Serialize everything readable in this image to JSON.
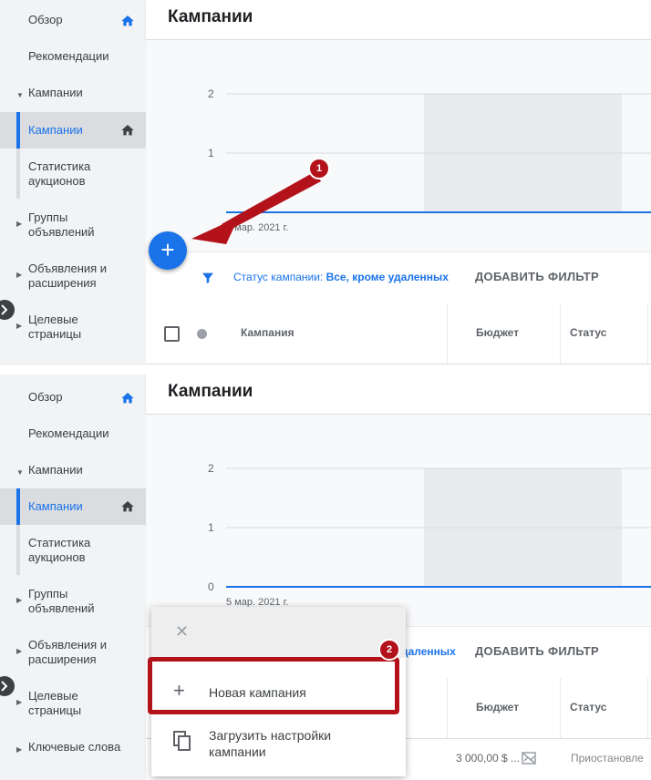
{
  "sidebar": {
    "items": [
      {
        "label": "Обзор"
      },
      {
        "label": "Рекомендации"
      },
      {
        "label": "Кампании"
      },
      {
        "label": "Кампании"
      },
      {
        "label": "Статистика аукционов"
      },
      {
        "label": "Группы объявлений"
      },
      {
        "label": "Объявления и расширения"
      },
      {
        "label": "Целевые страницы"
      },
      {
        "label": "Ключевые слова"
      }
    ]
  },
  "header": {
    "title": "Кампании"
  },
  "chart_data": {
    "type": "line",
    "y_ticks": [
      "2",
      "1",
      "0"
    ],
    "x_tick": "5 мар. 2021 г.",
    "ylim": [
      0,
      2
    ],
    "series": [
      {
        "values": [
          0,
          0
        ]
      }
    ]
  },
  "filter": {
    "status_label": "Статус кампании:",
    "status_value": "Все, кроме удаленных",
    "status_value_partial": "даленных",
    "add_filter": "ДОБАВИТЬ ФИЛЬТР"
  },
  "table": {
    "columns": [
      "Кампания",
      "Бюджет",
      "Статус"
    ],
    "row": {
      "budget": "3 000,00 $ ...",
      "status": "Приостановле"
    }
  },
  "fab": {
    "icon": "+"
  },
  "badges": [
    "1",
    "2"
  ],
  "popup": {
    "close": "✕",
    "new_campaign": "Новая кампания",
    "upload_settings": "Загрузить настройки кампании"
  },
  "colors": {
    "accent": "#1a73e8",
    "highlight": "#b3121b",
    "sidebar_bg": "#f1f3f4"
  }
}
